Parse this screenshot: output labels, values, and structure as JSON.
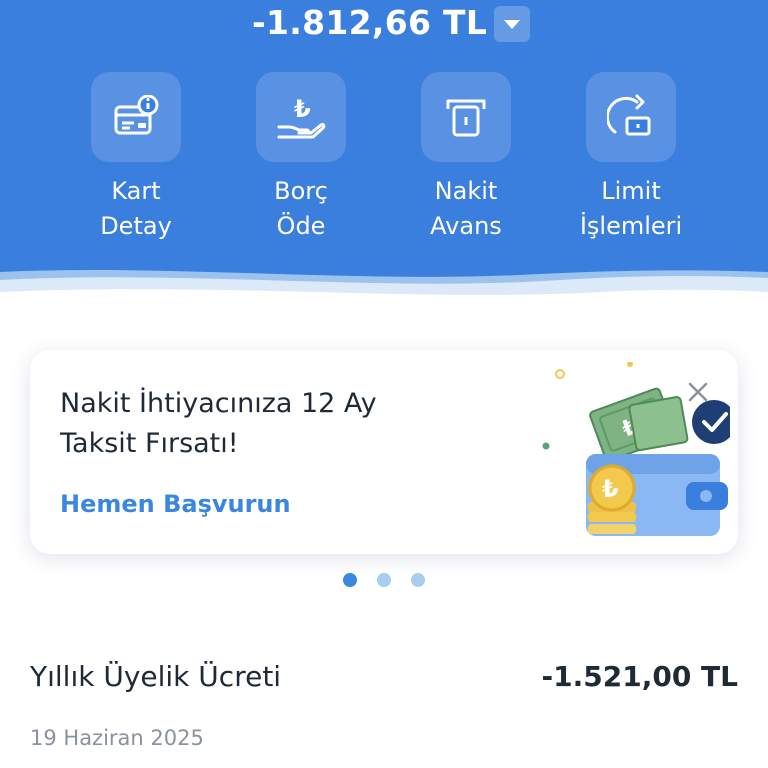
{
  "balance": {
    "amount": "-1.812,66 TL",
    "toggle_icon": "chevron-down-icon"
  },
  "actions": [
    {
      "label_line1": "Kart",
      "label_line2": "Detay",
      "icon": "card-info-icon"
    },
    {
      "label_line1": "Borç",
      "label_line2": "Öde",
      "icon": "lira-hand-icon"
    },
    {
      "label_line1": "Nakit",
      "label_line2": "Avans",
      "icon": "atm-cash-icon"
    },
    {
      "label_line1": "Limit",
      "label_line2": "İşlemleri",
      "icon": "limit-refresh-icon"
    }
  ],
  "promo": {
    "title": "Nakit İhtiyacınıza 12 Ay Taksit Fırsatı!",
    "cta": "Hemen Başvurun",
    "illustration": "wallet-cash-illustration",
    "close_icon": "close-icon"
  },
  "carousel": {
    "total": 3,
    "active_index": 0
  },
  "transaction": {
    "title": "Yıllık Üyelik Ücreti",
    "amount": "-1.521,00 TL",
    "date": "19 Haziran 2025"
  },
  "colors": {
    "header_bg": "#3a7ede",
    "accent": "#3a86e0",
    "text_dark": "#1f2a37",
    "text_muted": "#8a929c"
  }
}
